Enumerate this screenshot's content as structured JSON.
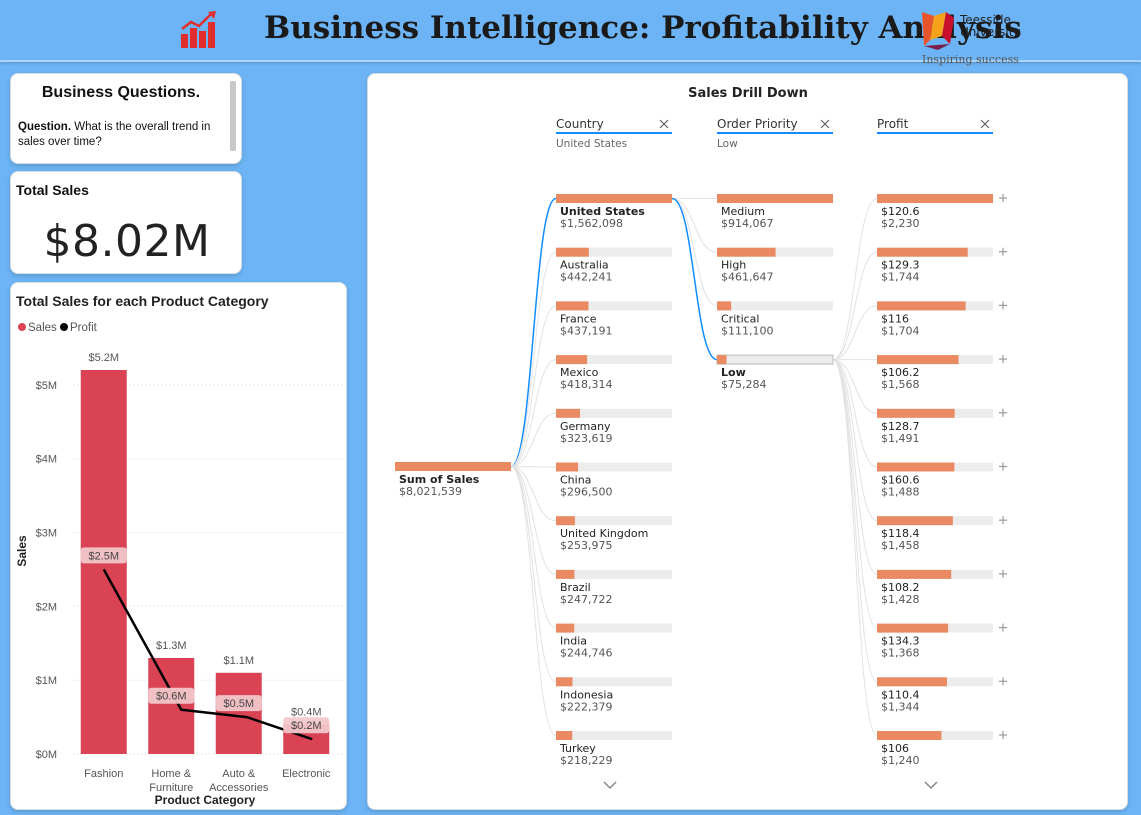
{
  "header": {
    "title": "Business Intelligence: Profitability Analysis",
    "chart_logo_icon": "bar-chart-trend-icon",
    "university_name_line1": "Teesside",
    "university_name_line2": "University",
    "university_slogan": "Inspiring success"
  },
  "colors": {
    "background": "#6cb4f5",
    "sales_bar": "#d94353",
    "profit_line": "#000000",
    "drill_bar": "#ea8a63",
    "drill_track": "#ececec",
    "selection_line": "#118dff"
  },
  "questions": {
    "title": "Business Questions.",
    "question_label": "Question.",
    "question_text": "What is the overall trend in sales over time?"
  },
  "total_sales": {
    "title": "Total Sales",
    "value": "$8.02M"
  },
  "category_chart": {
    "title": "Total Sales for each Product Category",
    "legend": [
      "Sales",
      "Profit"
    ],
    "xlabel": "Product Category",
    "ylabel": "Sales",
    "yticks": [
      "$0M",
      "$1M",
      "$2M",
      "$3M",
      "$4M",
      "$5M"
    ]
  },
  "chart_data": {
    "type": "bar",
    "title": "Total Sales for each Product Category",
    "categories": [
      [
        "Fashion"
      ],
      [
        "Home &",
        "Furniture"
      ],
      [
        "Auto &",
        "Accessories"
      ],
      [
        "Electronic"
      ]
    ],
    "series": [
      {
        "name": "Sales",
        "type": "bar",
        "values": [
          5.2,
          1.3,
          1.1,
          0.4
        ],
        "labels": [
          "$5.2M",
          "$1.3M",
          "$1.1M",
          "$0.4M"
        ]
      },
      {
        "name": "Profit",
        "type": "line",
        "values": [
          2.5,
          0.6,
          0.5,
          0.2
        ],
        "labels": [
          "$2.5M",
          "$0.6M",
          "$0.5M",
          "$0.2M"
        ]
      }
    ],
    "xlabel": "Product Category",
    "ylabel": "Sales",
    "ylim": [
      0,
      5.2
    ],
    "legend_position": "top-left",
    "grid": true
  },
  "drill_down": {
    "title": "Sales Drill Down",
    "root": {
      "label": "Sum of Sales",
      "value": "$8,021,539"
    },
    "columns": [
      {
        "header": "Country",
        "filter": "United States",
        "close_icon": "close-icon"
      },
      {
        "header": "Order Priority",
        "filter": "Low",
        "close_icon": "close-icon"
      },
      {
        "header": "Profit",
        "filter": "",
        "close_icon": "close-icon"
      }
    ],
    "countries": [
      {
        "name": "United States",
        "value": "$1,562,098",
        "fill": 1.0,
        "selected": true
      },
      {
        "name": "Australia",
        "value": "$442,241",
        "fill": 0.283
      },
      {
        "name": "France",
        "value": "$437,191",
        "fill": 0.28
      },
      {
        "name": "Mexico",
        "value": "$418,314",
        "fill": 0.268
      },
      {
        "name": "Germany",
        "value": "$323,619",
        "fill": 0.207
      },
      {
        "name": "China",
        "value": "$296,500",
        "fill": 0.19
      },
      {
        "name": "United Kingdom",
        "value": "$253,975",
        "fill": 0.163
      },
      {
        "name": "Brazil",
        "value": "$247,722",
        "fill": 0.159
      },
      {
        "name": "India",
        "value": "$244,746",
        "fill": 0.157
      },
      {
        "name": "Indonesia",
        "value": "$222,379",
        "fill": 0.142
      },
      {
        "name": "Turkey",
        "value": "$218,229",
        "fill": 0.14
      }
    ],
    "priorities": [
      {
        "name": "Medium",
        "value": "$914,067",
        "fill": 1.0
      },
      {
        "name": "High",
        "value": "$461,647",
        "fill": 0.505
      },
      {
        "name": "Critical",
        "value": "$111,100",
        "fill": 0.122
      },
      {
        "name": "Low",
        "value": "$75,284",
        "fill": 0.082,
        "selected": true
      }
    ],
    "profits": [
      {
        "name": "$120.6",
        "value": "$2,230",
        "fill": 1.0
      },
      {
        "name": "$129.3",
        "value": "$1,744",
        "fill": 0.782
      },
      {
        "name": "$116",
        "value": "$1,704",
        "fill": 0.764
      },
      {
        "name": "$106.2",
        "value": "$1,568",
        "fill": 0.703
      },
      {
        "name": "$128.7",
        "value": "$1,491",
        "fill": 0.669
      },
      {
        "name": "$160.6",
        "value": "$1,488",
        "fill": 0.667
      },
      {
        "name": "$118.4",
        "value": "$1,458",
        "fill": 0.654
      },
      {
        "name": "$108.2",
        "value": "$1,428",
        "fill": 0.64
      },
      {
        "name": "$134.3",
        "value": "$1,368",
        "fill": 0.613
      },
      {
        "name": "$110.4",
        "value": "$1,344",
        "fill": 0.603
      },
      {
        "name": "$106",
        "value": "$1,240",
        "fill": 0.556
      }
    ],
    "expand_icon": "plus-icon",
    "scroll_icon": "chevron-down-icon"
  }
}
